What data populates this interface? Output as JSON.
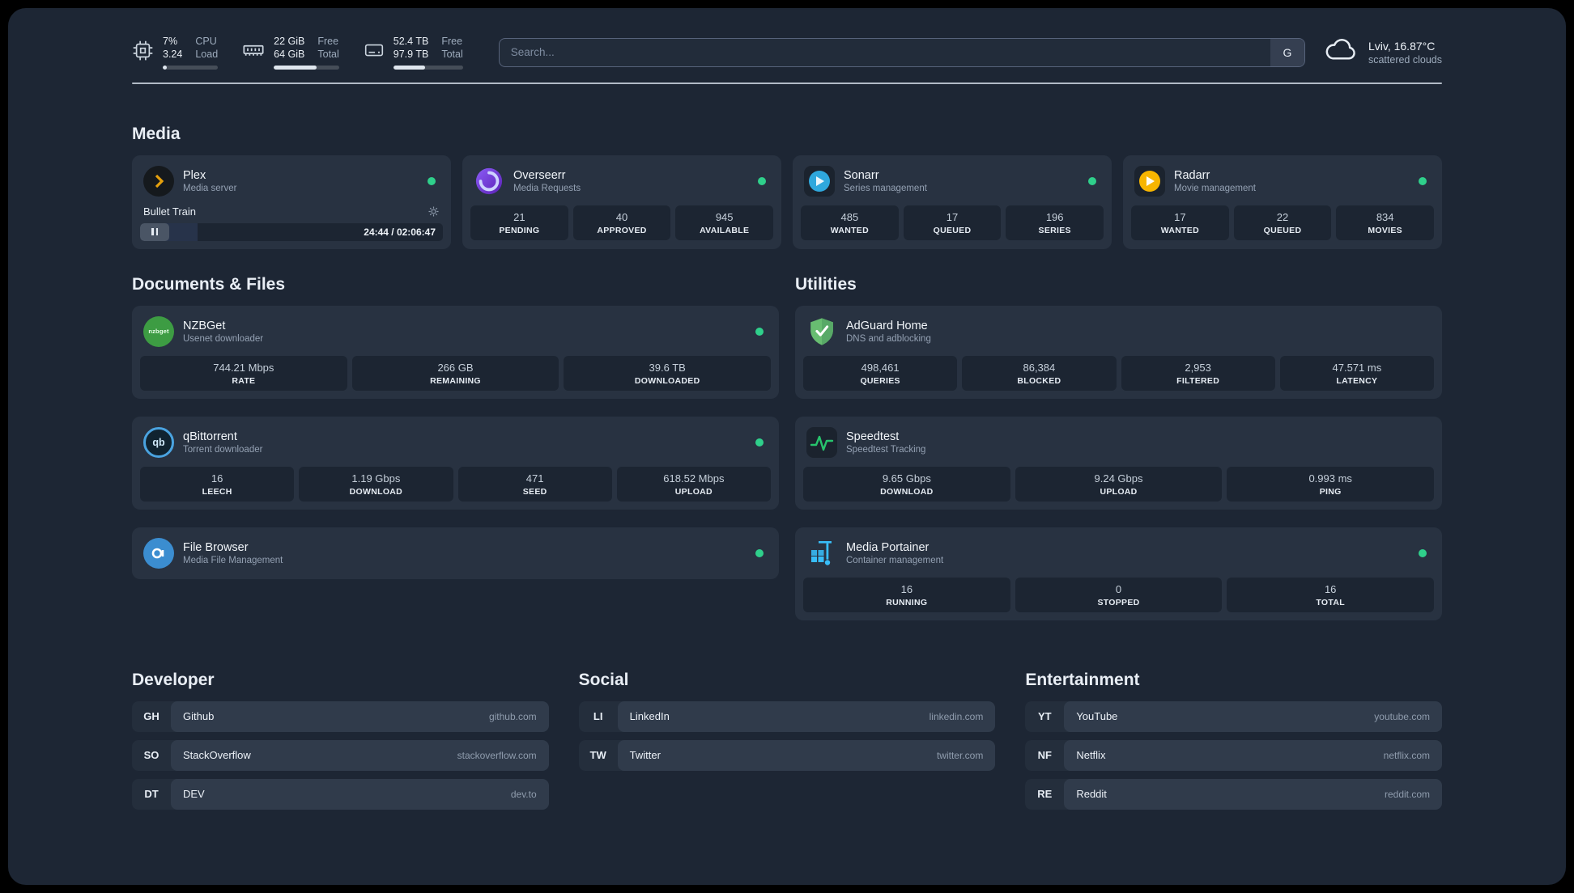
{
  "colors": {
    "status_green": "#2fd08b",
    "accent_blue": "#38bdf8",
    "plex_gold": "#e5a00d"
  },
  "topbar": {
    "cpu": {
      "value_top": "7%",
      "value_bottom": "3.24",
      "label_top": "CPU",
      "label_bottom": "Load",
      "bar_pct": 7
    },
    "memory": {
      "value_top": "22 GiB",
      "value_bottom": "64 GiB",
      "label_top": "Free",
      "label_bottom": "Total",
      "bar_pct": 66
    },
    "disk": {
      "value_top": "52.4 TB",
      "value_bottom": "97.9 TB",
      "label_top": "Free",
      "label_bottom": "Total",
      "bar_pct": 46
    },
    "search": {
      "placeholder": "Search...",
      "provider_label": "G"
    },
    "weather": {
      "location": "Lviv, 16.87°C",
      "condition": "scattered clouds"
    }
  },
  "sections": {
    "media": {
      "title": "Media",
      "plex": {
        "name": "Plex",
        "desc": "Media server",
        "now_playing": "Bullet Train",
        "time": "24:44 / 02:06:47",
        "progress_pct": 19
      },
      "overseerr": {
        "name": "Overseerr",
        "desc": "Media Requests",
        "stats": [
          {
            "value": "21",
            "label": "PENDING"
          },
          {
            "value": "40",
            "label": "APPROVED"
          },
          {
            "value": "945",
            "label": "AVAILABLE"
          }
        ]
      },
      "sonarr": {
        "name": "Sonarr",
        "desc": "Series management",
        "stats": [
          {
            "value": "485",
            "label": "WANTED"
          },
          {
            "value": "17",
            "label": "QUEUED"
          },
          {
            "value": "196",
            "label": "SERIES"
          }
        ]
      },
      "radarr": {
        "name": "Radarr",
        "desc": "Movie management",
        "stats": [
          {
            "value": "17",
            "label": "WANTED"
          },
          {
            "value": "22",
            "label": "QUEUED"
          },
          {
            "value": "834",
            "label": "MOVIES"
          }
        ]
      }
    },
    "documents": {
      "title": "Documents & Files",
      "nzbget": {
        "name": "NZBGet",
        "desc": "Usenet downloader",
        "icon_text": "nzbget",
        "stats": [
          {
            "value": "744.21 Mbps",
            "label": "RATE"
          },
          {
            "value": "266 GB",
            "label": "REMAINING"
          },
          {
            "value": "39.6 TB",
            "label": "DOWNLOADED"
          }
        ]
      },
      "qbittorrent": {
        "name": "qBittorrent",
        "desc": "Torrent downloader",
        "icon_text": "qb",
        "stats": [
          {
            "value": "16",
            "label": "LEECH"
          },
          {
            "value": "1.19 Gbps",
            "label": "DOWNLOAD"
          },
          {
            "value": "471",
            "label": "SEED"
          },
          {
            "value": "618.52 Mbps",
            "label": "UPLOAD"
          }
        ]
      },
      "filebrowser": {
        "name": "File Browser",
        "desc": "Media File Management"
      }
    },
    "utilities": {
      "title": "Utilities",
      "adguard": {
        "name": "AdGuard Home",
        "desc": "DNS and adblocking",
        "stats": [
          {
            "value": "498,461",
            "label": "QUERIES"
          },
          {
            "value": "86,384",
            "label": "BLOCKED"
          },
          {
            "value": "2,953",
            "label": "FILTERED"
          },
          {
            "value": "47.571 ms",
            "label": "LATENCY"
          }
        ]
      },
      "speedtest": {
        "name": "Speedtest",
        "desc": "Speedtest Tracking",
        "stats": [
          {
            "value": "9.65 Gbps",
            "label": "DOWNLOAD"
          },
          {
            "value": "9.24 Gbps",
            "label": "UPLOAD"
          },
          {
            "value": "0.993 ms",
            "label": "PING"
          }
        ]
      },
      "portainer": {
        "name": "Media Portainer",
        "desc": "Container management",
        "stats": [
          {
            "value": "16",
            "label": "RUNNING"
          },
          {
            "value": "0",
            "label": "STOPPED"
          },
          {
            "value": "16",
            "label": "TOTAL"
          }
        ]
      }
    }
  },
  "bookmarks": {
    "developer": {
      "title": "Developer",
      "items": [
        {
          "abbr": "GH",
          "name": "Github",
          "url": "github.com"
        },
        {
          "abbr": "SO",
          "name": "StackOverflow",
          "url": "stackoverflow.com"
        },
        {
          "abbr": "DT",
          "name": "DEV",
          "url": "dev.to"
        }
      ]
    },
    "social": {
      "title": "Social",
      "items": [
        {
          "abbr": "LI",
          "name": "LinkedIn",
          "url": "linkedin.com"
        },
        {
          "abbr": "TW",
          "name": "Twitter",
          "url": "twitter.com"
        }
      ]
    },
    "entertainment": {
      "title": "Entertainment",
      "items": [
        {
          "abbr": "YT",
          "name": "YouTube",
          "url": "youtube.com"
        },
        {
          "abbr": "NF",
          "name": "Netflix",
          "url": "netflix.com"
        },
        {
          "abbr": "RE",
          "name": "Reddit",
          "url": "reddit.com"
        }
      ]
    }
  }
}
